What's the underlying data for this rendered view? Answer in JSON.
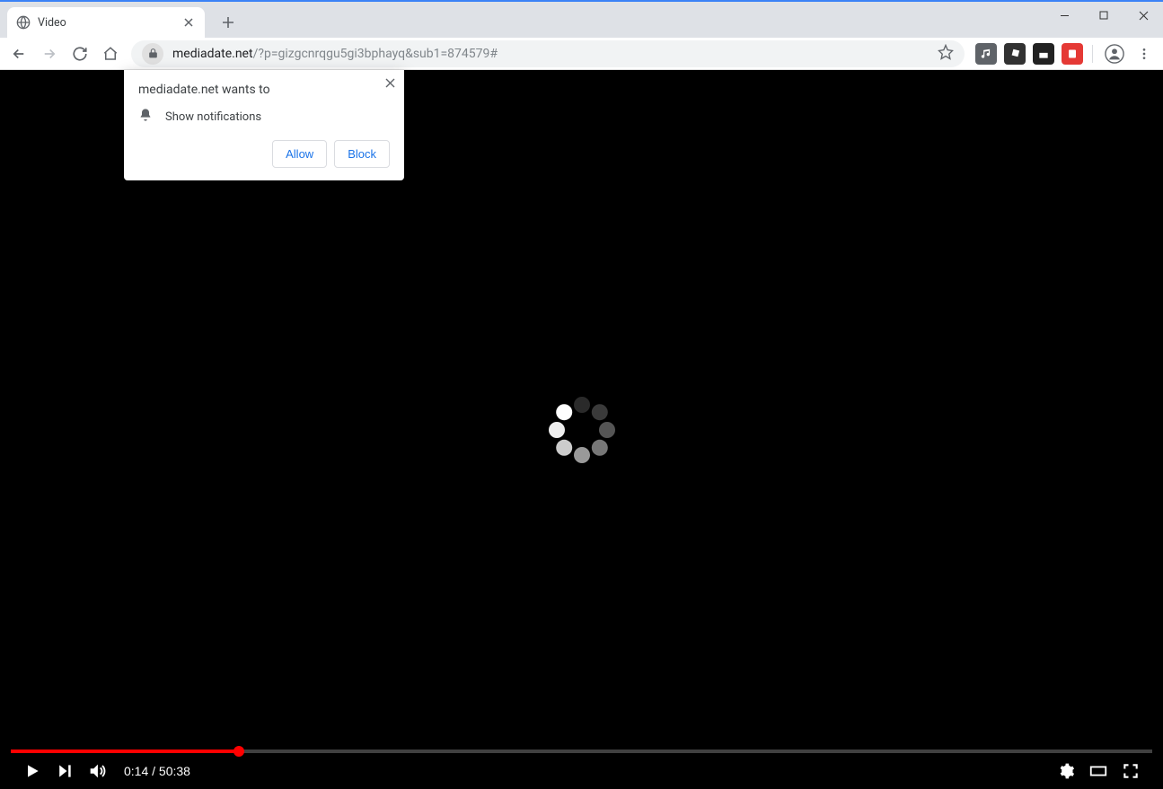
{
  "tab": {
    "title": "Video"
  },
  "url": {
    "domain": "mediadate.net",
    "path": "/?p=gizgcnrqgu5gi3bphayq&sub1=874579#"
  },
  "permission_popup": {
    "title": "mediadate.net wants to",
    "item": "Show notifications",
    "allow_label": "Allow",
    "block_label": "Block"
  },
  "video": {
    "current_time": "0:14",
    "total_time": "50:38",
    "progress_percent": 20
  }
}
